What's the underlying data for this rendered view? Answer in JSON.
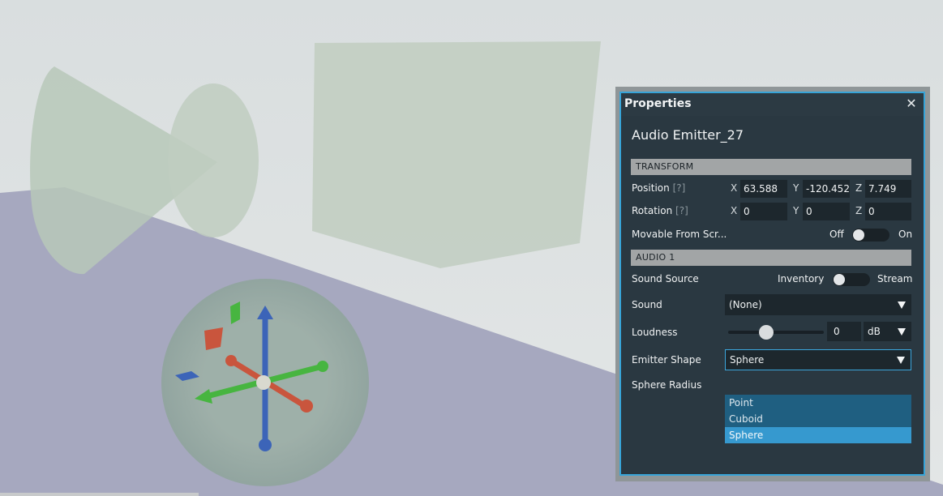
{
  "panel": {
    "title": "Properties",
    "close_glyph": "✕",
    "object_name": "Audio Emitter_27"
  },
  "transform": {
    "header": "TRANSFORM",
    "position": {
      "label": "Position",
      "help": "[?]",
      "axes": [
        "X",
        "Y",
        "Z"
      ],
      "values": [
        "63.588",
        "-120.452",
        "7.749"
      ]
    },
    "rotation": {
      "label": "Rotation",
      "help": "[?]",
      "axes": [
        "X",
        "Y",
        "Z"
      ],
      "values": [
        "0",
        "0",
        "0"
      ]
    },
    "movable": {
      "label": "Movable From Scr...",
      "off_label": "Off",
      "on_label": "On",
      "state": "off"
    }
  },
  "audio": {
    "header": "AUDIO 1",
    "sound_source": {
      "label": "Sound Source",
      "left_option": "Inventory",
      "right_option": "Stream",
      "state": "left"
    },
    "sound": {
      "label": "Sound",
      "value": "(None)"
    },
    "loudness": {
      "label": "Loudness",
      "value": "0",
      "unit": "dB",
      "slider_fraction": 0.4
    },
    "emitter_shape": {
      "label": "Emitter Shape",
      "value": "Sphere",
      "options": [
        "Point",
        "Cuboid",
        "Sphere"
      ],
      "selected_index": 2
    },
    "sphere_radius": {
      "label": "Sphere Radius"
    }
  },
  "colors": {
    "accent": "#37a4d8",
    "panel_bg": "#2a3841",
    "gizmo_x": "#c9553d",
    "gizmo_y": "#3f9e3a",
    "gizmo_z": "#3c64b8"
  },
  "icons": {
    "close": "close-icon",
    "dropdown": "chevron-down-icon",
    "gizmo": "transform-gizmo-icon"
  }
}
